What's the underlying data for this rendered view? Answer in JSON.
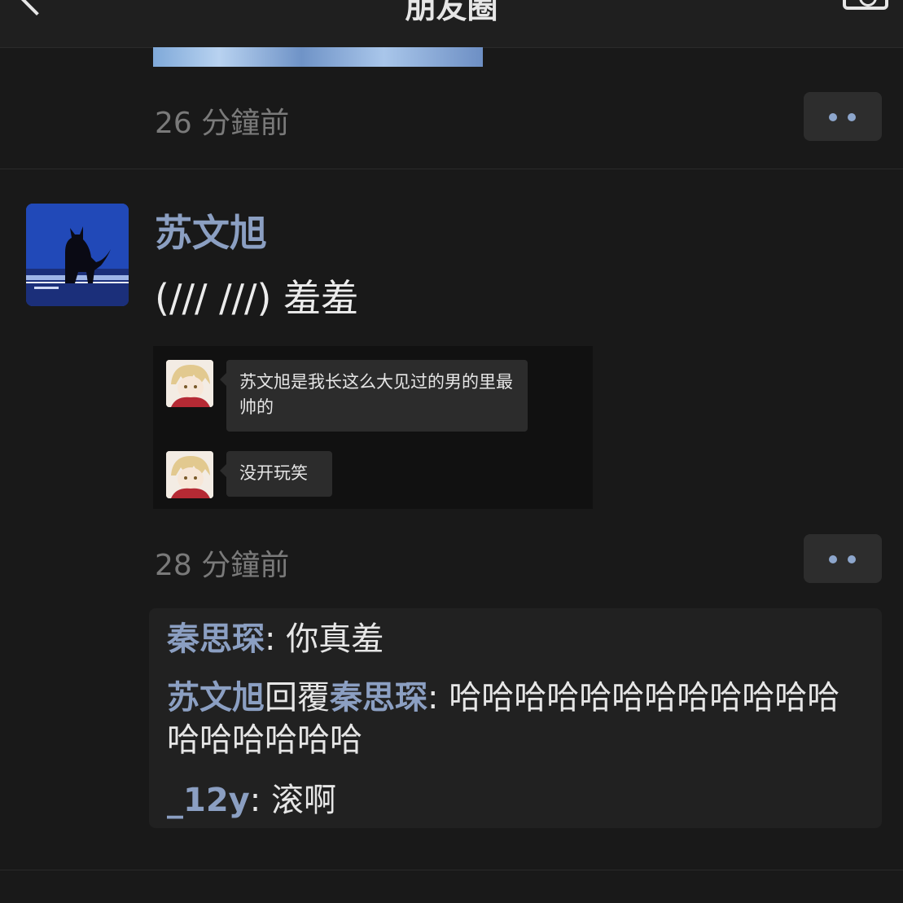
{
  "nav": {
    "title": "朋友圈"
  },
  "previous_post": {
    "time": "26 分鐘前"
  },
  "post": {
    "author": "苏文旭",
    "text": "(/// ///) 羞羞",
    "time": "28 分鐘前",
    "screenshot": {
      "messages": [
        {
          "text": "苏文旭是我长这么大见过的男的里最帅的"
        },
        {
          "text": "没开玩笑"
        }
      ]
    },
    "comments": [
      {
        "author": "秦思琛",
        "separator": ": ",
        "text": "你真羞"
      },
      {
        "author": "苏文旭",
        "reply_word": "回覆",
        "reply_to": "秦思琛",
        "separator": ": ",
        "text": "哈哈哈哈哈哈哈哈哈哈哈哈哈哈哈哈哈哈"
      },
      {
        "author": "_12y",
        "separator": ": ",
        "text": "滚啊"
      }
    ]
  },
  "colors": {
    "background": "#191919",
    "name_blue": "#8b9fc2",
    "muted_gray": "#7a7a7a",
    "panel": "#212121"
  },
  "icons": [
    "chevron-left-icon",
    "camera-icon",
    "more-dots-icon"
  ]
}
